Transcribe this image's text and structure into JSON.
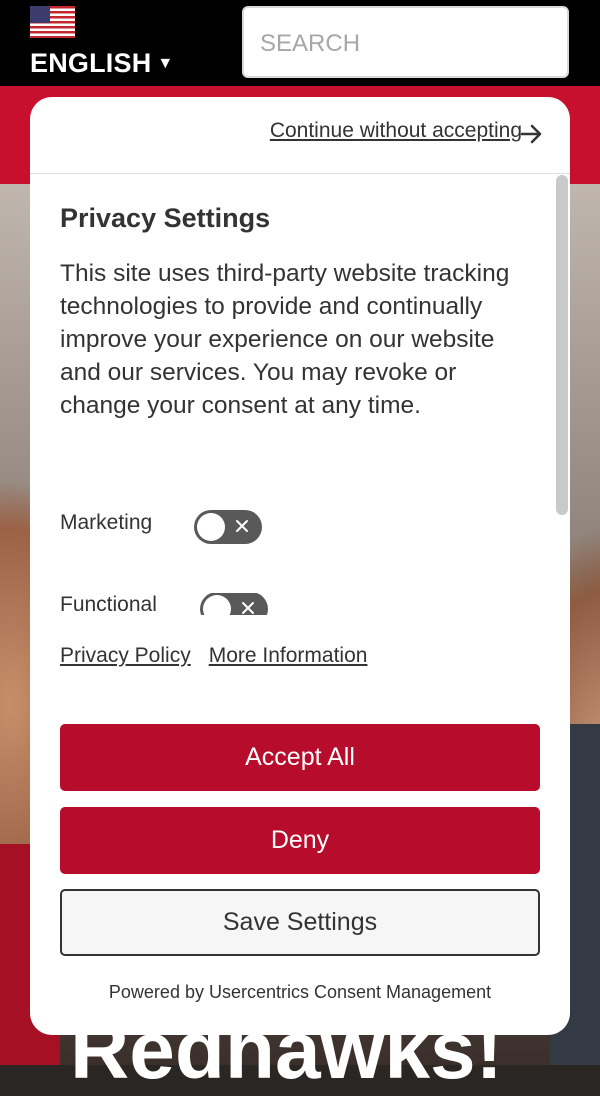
{
  "header": {
    "language_label": "ENGLISH",
    "language_caret": "▼",
    "search_placeholder": "SEARCH"
  },
  "hero": {
    "headline_partial": "Redhawks!"
  },
  "consent": {
    "continue_label": "Continue without accepting",
    "title": "Privacy Settings",
    "description": "This site uses third-party website tracking technologies to provide and continually improve your experience on our website and our services. You may revoke or change your consent at any time.",
    "toggles": [
      {
        "label": "Marketing",
        "enabled": false
      },
      {
        "label": "Functional",
        "enabled": false
      }
    ],
    "privacy_policy_label": "Privacy Policy",
    "more_info_label": "More Information",
    "accept_all_label": "Accept All",
    "deny_label": "Deny",
    "save_settings_label": "Save Settings",
    "powered_by": "Powered by Usercentrics Consent Management"
  },
  "colors": {
    "brand_red": "#b80c2c",
    "header_band_red": "#c8102e",
    "toggle_off": "#595959"
  },
  "icons": [
    "us-flag-icon",
    "arrow-right-icon",
    "x-icon"
  ]
}
